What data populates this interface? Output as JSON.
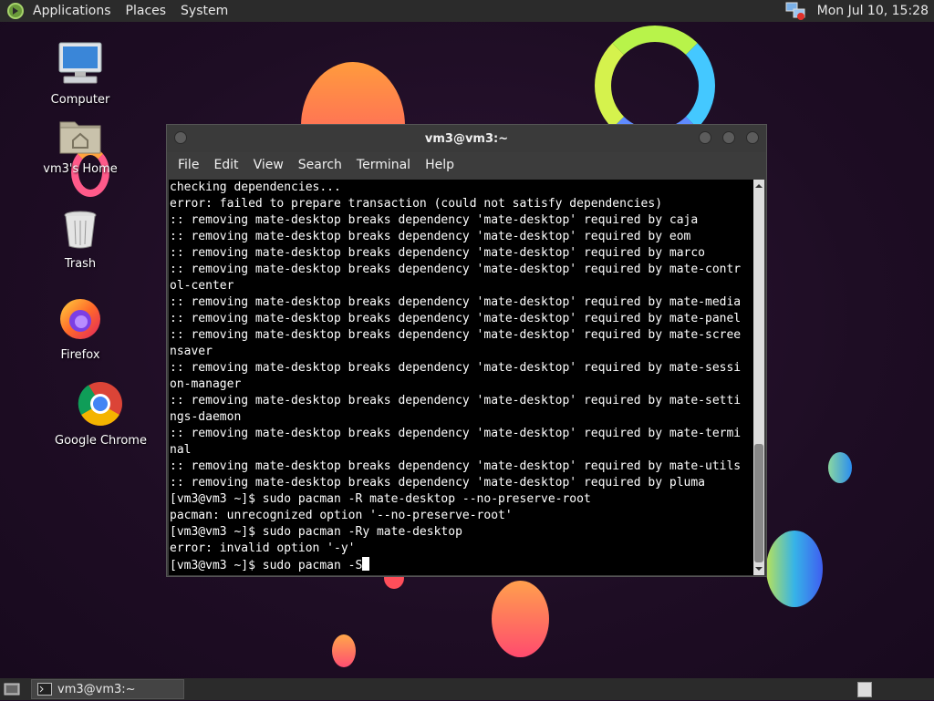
{
  "top_panel": {
    "menus": [
      "Applications",
      "Places",
      "System"
    ],
    "clock": "Mon Jul 10, 15:28"
  },
  "desktop_icons": [
    {
      "label": "Computer"
    },
    {
      "label": "vm3's Home"
    },
    {
      "label": "Trash"
    },
    {
      "label": "Firefox"
    },
    {
      "label": "Google Chrome"
    }
  ],
  "window": {
    "title": "vm3@vm3:~",
    "menus": [
      "File",
      "Edit",
      "View",
      "Search",
      "Terminal",
      "Help"
    ],
    "lines": [
      "checking dependencies...",
      "error: failed to prepare transaction (could not satisfy dependencies)",
      ":: removing mate-desktop breaks dependency 'mate-desktop' required by caja",
      ":: removing mate-desktop breaks dependency 'mate-desktop' required by eom",
      ":: removing mate-desktop breaks dependency 'mate-desktop' required by marco",
      ":: removing mate-desktop breaks dependency 'mate-desktop' required by mate-contr",
      "ol-center",
      ":: removing mate-desktop breaks dependency 'mate-desktop' required by mate-media",
      ":: removing mate-desktop breaks dependency 'mate-desktop' required by mate-panel",
      ":: removing mate-desktop breaks dependency 'mate-desktop' required by mate-scree",
      "nsaver",
      ":: removing mate-desktop breaks dependency 'mate-desktop' required by mate-sessi",
      "on-manager",
      ":: removing mate-desktop breaks dependency 'mate-desktop' required by mate-setti",
      "ngs-daemon",
      ":: removing mate-desktop breaks dependency 'mate-desktop' required by mate-termi",
      "nal",
      ":: removing mate-desktop breaks dependency 'mate-desktop' required by mate-utils",
      ":: removing mate-desktop breaks dependency 'mate-desktop' required by pluma",
      "[vm3@vm3 ~]$ sudo pacman -R mate-desktop --no-preserve-root",
      "pacman: unrecognized option '--no-preserve-root'",
      "[vm3@vm3 ~]$ sudo pacman -Ry mate-desktop",
      "error: invalid option '-y'"
    ],
    "prompt_line": "[vm3@vm3 ~]$ sudo pacman -S"
  },
  "taskbar": {
    "task_label": "vm3@vm3:~"
  },
  "icons": {
    "app_menu": "mate-logo-icon",
    "network": "network-icon",
    "terminal": "terminal-icon",
    "show_desktop": "show-desktop-icon",
    "workspace": "workspace-switcher-icon"
  },
  "colors": {
    "panel": "#2b2b2b",
    "terminal_bg": "#000000",
    "terminal_fg": "#ffffff",
    "desktop_bg": "#1f0f27"
  }
}
